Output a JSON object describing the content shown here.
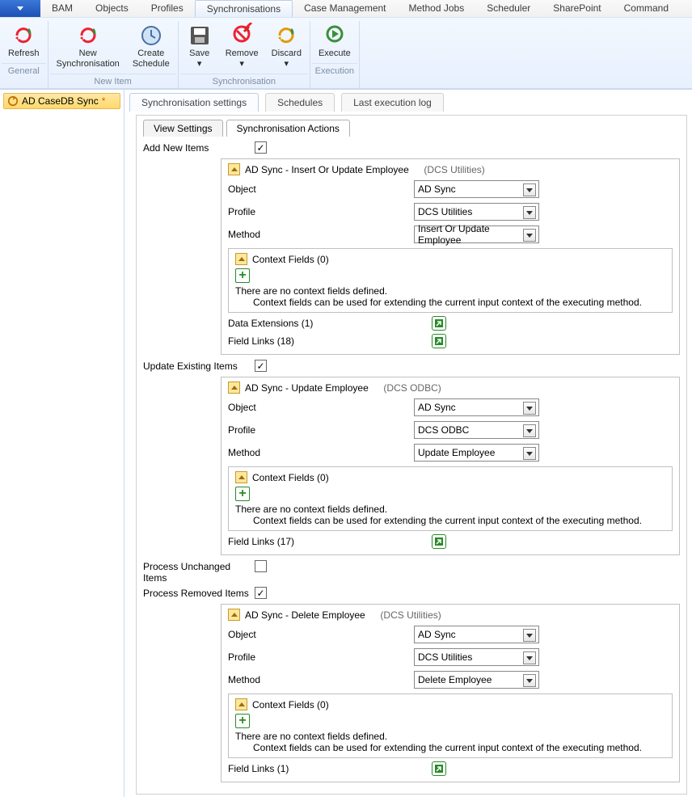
{
  "menu": {
    "items": [
      "BAM",
      "Objects",
      "Profiles",
      "Synchronisations",
      "Case Management",
      "Method Jobs",
      "Scheduler",
      "SharePoint",
      "Command"
    ],
    "active": 3
  },
  "toolbar": {
    "groups": [
      {
        "label": "General",
        "buttons": [
          {
            "label": "Refresh",
            "icon": "refresh"
          }
        ]
      },
      {
        "label": "New Item",
        "buttons": [
          {
            "label": "New\nSynchronisation",
            "icon": "newsync"
          },
          {
            "label": "Create\nSchedule",
            "icon": "clock"
          }
        ]
      },
      {
        "label": "Synchronisation",
        "buttons": [
          {
            "label": "Save",
            "icon": "save",
            "dropdown": true
          },
          {
            "label": "Remove",
            "icon": "remove",
            "dropdown": true
          },
          {
            "label": "Discard",
            "icon": "discard",
            "dropdown": true
          }
        ]
      },
      {
        "label": "Execution",
        "buttons": [
          {
            "label": "Execute",
            "icon": "execute"
          }
        ]
      }
    ]
  },
  "sidebar": {
    "item": "AD CaseDB Sync",
    "dirty": "*"
  },
  "tabs1": [
    "Synchronisation settings",
    "Schedules",
    "Last execution log"
  ],
  "tabs2": [
    "View Settings",
    "Synchronisation Actions"
  ],
  "tabs2_active": 1,
  "sections": [
    {
      "label": "Add New Items",
      "checked": true,
      "action": {
        "title": "AD Sync   - Insert Or Update Employee",
        "suffix": "(DCS Utilities)",
        "object": "AD Sync",
        "profile": "DCS Utilities",
        "method": "Insert Or Update Employee",
        "context_label": "Context Fields  (0)",
        "ctx_msg1": "There are no context fields defined.",
        "ctx_msg2": "Context fields can be used for extending the current input context of the executing method.",
        "extras": [
          {
            "label": "Data Extensions  (1)"
          },
          {
            "label": "Field Links  (18)"
          }
        ]
      }
    },
    {
      "label": "Update Existing Items",
      "checked": true,
      "action": {
        "title": "AD Sync   - Update Employee",
        "suffix": "(DCS ODBC)",
        "object": "AD Sync",
        "profile": "DCS ODBC",
        "method": "Update Employee",
        "context_label": "Context Fields  (0)",
        "ctx_msg1": "There are no context fields defined.",
        "ctx_msg2": "Context fields can be used for extending the current input context of the executing method.",
        "extras": [
          {
            "label": "Field Links  (17)"
          }
        ]
      }
    },
    {
      "label": "Process Unchanged Items",
      "checked": false
    },
    {
      "label": "Process Removed Items",
      "checked": true,
      "action": {
        "title": "AD Sync   - Delete Employee",
        "suffix": "(DCS Utilities)",
        "object": "AD Sync",
        "profile": "DCS Utilities",
        "method": "Delete Employee",
        "context_label": "Context Fields  (0)",
        "ctx_msg1": "There are no context fields defined.",
        "ctx_msg2": "Context fields can be used for extending the current input context of the executing method.",
        "extras": [
          {
            "label": "Field Links  (1)"
          }
        ]
      }
    }
  ],
  "form_labels": {
    "object": "Object",
    "profile": "Profile",
    "method": "Method"
  }
}
